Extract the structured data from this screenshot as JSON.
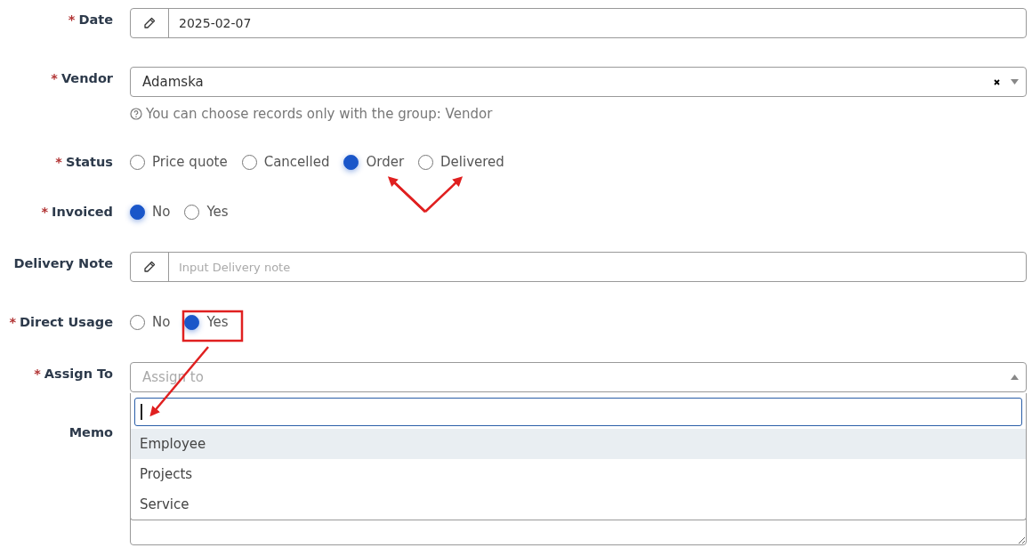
{
  "fields": [
    {
      "kind": "text",
      "label": "Date",
      "required_mark": "*",
      "value": "2025-02-07"
    },
    {
      "kind": "select",
      "label": "Vendor",
      "required_mark": "*",
      "value": "Adamska",
      "hint": "You can choose records only with the group: Vendor"
    },
    {
      "kind": "radio",
      "label": "Status",
      "required_mark": "*",
      "options": [
        {
          "label": "Price quote",
          "selected": false
        },
        {
          "label": "Cancelled",
          "selected": false
        },
        {
          "label": "Order",
          "selected": true
        },
        {
          "label": "Delivered",
          "selected": false
        }
      ]
    },
    {
      "kind": "radio",
      "label": "Invoiced",
      "required_mark": "*",
      "options": [
        {
          "label": "No",
          "selected": true
        },
        {
          "label": "Yes",
          "selected": false
        }
      ]
    },
    {
      "kind": "text",
      "label": "Delivery Note",
      "placeholder": "Input Delivery note"
    },
    {
      "kind": "radio",
      "label": "Direct Usage",
      "required_mark": "*",
      "options": [
        {
          "label": "No",
          "selected": false
        },
        {
          "label": "Yes",
          "selected": true
        }
      ]
    },
    {
      "kind": "dropdown",
      "label": "Assign To",
      "required_mark": "*",
      "placeholder": "Assign to",
      "expanded": true,
      "options": [
        {
          "label": "Employee",
          "selected": true
        },
        {
          "label": "Projects",
          "selected": false
        },
        {
          "label": "Service",
          "selected": false
        }
      ]
    },
    {
      "kind": "textarea",
      "label": "Memo"
    }
  ]
}
